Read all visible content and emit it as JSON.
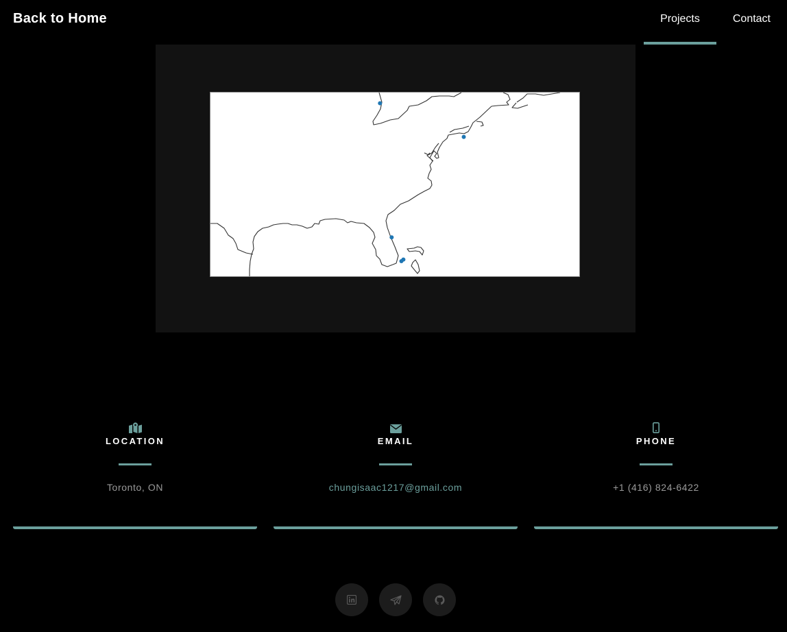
{
  "nav": {
    "home_label": "Back to Home",
    "links": [
      {
        "label": "Projects",
        "active": true
      },
      {
        "label": "Contact",
        "active": false
      }
    ]
  },
  "map": {
    "point_color": "#1f77b4",
    "points": [
      {
        "lon": -82.6,
        "lat": 44.8
      },
      {
        "lon": -74.0,
        "lat": 40.7
      },
      {
        "lon": -81.4,
        "lat": 28.5
      },
      {
        "lon": -80.2,
        "lat": 25.8
      },
      {
        "lon": -80.4,
        "lat": 25.6
      }
    ]
  },
  "contact": {
    "location": {
      "icon": "map-marked-icon",
      "title": "LOCATION",
      "value": "Toronto, ON"
    },
    "email": {
      "icon": "envelope-icon",
      "title": "EMAIL",
      "value": "chungisaac1217@gmail.com"
    },
    "phone": {
      "icon": "mobile-phone-icon",
      "title": "PHONE",
      "value": "+1 (416) 824-6422"
    }
  },
  "socials": [
    {
      "icon": "linkedin-icon"
    },
    {
      "icon": "paper-plane-icon"
    },
    {
      "icon": "github-icon"
    }
  ],
  "colors": {
    "accent": "#6b9f9c",
    "background": "#000000",
    "panel": "#121212",
    "muted_text": "#9a9a9a"
  }
}
